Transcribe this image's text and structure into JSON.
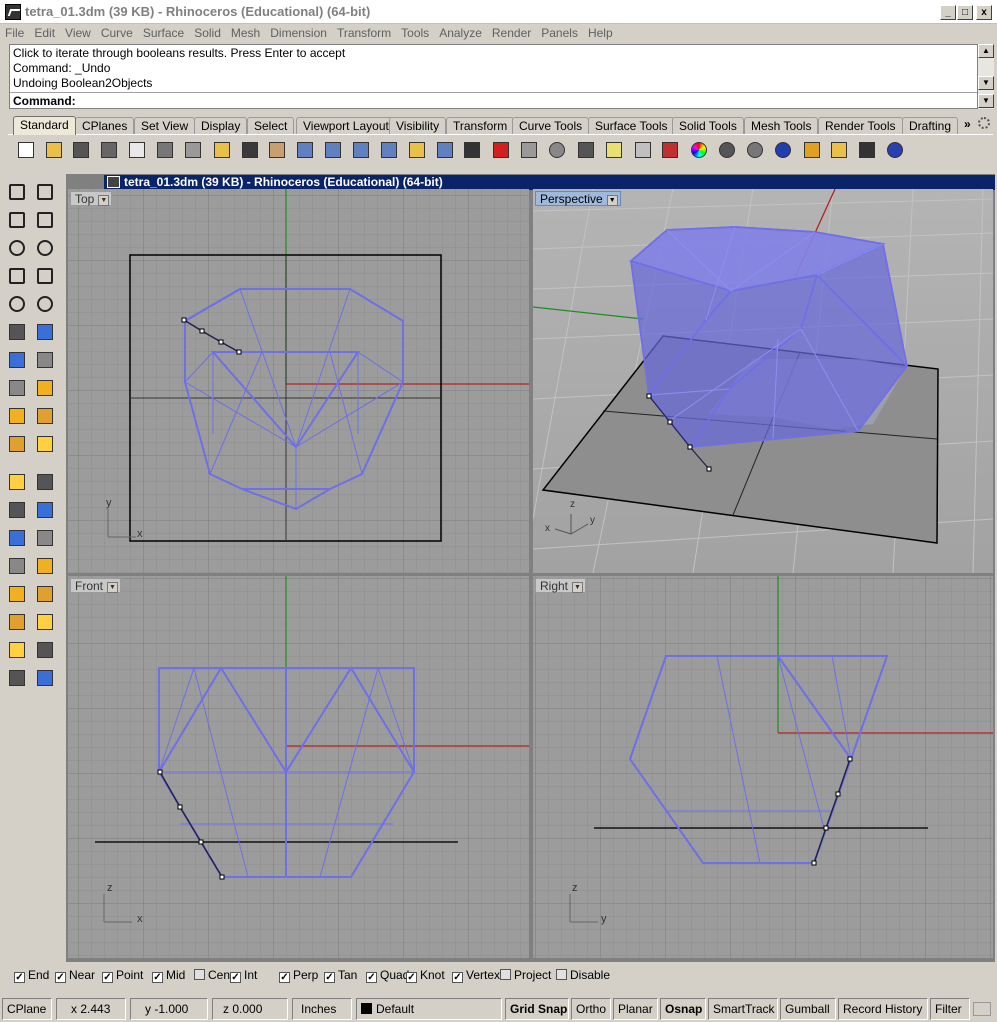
{
  "window": {
    "title": "tetra_01.3dm (39 KB) - Rhinoceros (Educational) (64-bit)",
    "min_label": "_",
    "max_label": "□",
    "close_label": "x"
  },
  "menu": [
    "File",
    "Edit",
    "View",
    "Curve",
    "Surface",
    "Solid",
    "Mesh",
    "Dimension",
    "Transform",
    "Tools",
    "Analyze",
    "Render",
    "Panels",
    "Help"
  ],
  "command": {
    "history": [
      "Click to iterate through booleans results. Press Enter to accept",
      "Command: _Undo",
      "Undoing Boolean2Objects"
    ],
    "prompt_label": "Command:",
    "value": ""
  },
  "toolbar_tabs": [
    "Standard",
    "CPlanes",
    "Set View",
    "Display",
    "Select",
    "Viewport Layout",
    "Visibility",
    "Transform",
    "Curve Tools",
    "Surface Tools",
    "Solid Tools",
    "Mesh Tools",
    "Render Tools",
    "Drafting"
  ],
  "tabs_overflow": "»",
  "standard_icons": [
    "new-file-icon",
    "open-folder-icon",
    "save-icon",
    "print-icon",
    "import-icon",
    "cut-icon",
    "copy-icon",
    "paste-icon",
    "undo-icon",
    "pan-hand-icon",
    "rotate-view-icon",
    "zoom-dynamic-icon",
    "zoom-window-icon",
    "zoom-extents-icon",
    "zoom-selected-icon",
    "undo-view-icon",
    "four-viewports-icon",
    "car-icon",
    "grid-icon",
    "circle-select-icon",
    "point-icon",
    "bulb-icon",
    "lock-icon",
    "layer-icon",
    "color-wheel-icon",
    "shaded-sphere-icon",
    "rendered-sphere-icon",
    "blue-sphere-icon",
    "pen-icon",
    "gear-icon",
    "dimension-icon",
    "help-icon"
  ],
  "mdi_title": "tetra_01.3dm (39 KB) - Rhinoceros (Educational) (64-bit)",
  "viewports": {
    "top": {
      "label": "Top",
      "axis_x": "x",
      "axis_y": "y"
    },
    "perspective": {
      "label": "Perspective",
      "axis_x": "x",
      "axis_y": "y",
      "axis_z": "z"
    },
    "front": {
      "label": "Front",
      "axis_x": "x",
      "axis_y": "z"
    },
    "right": {
      "label": "Right",
      "axis_x": "y",
      "axis_y": "z"
    }
  },
  "osnaps": [
    {
      "label": "End",
      "checked": true
    },
    {
      "label": "Near",
      "checked": true
    },
    {
      "label": "Point",
      "checked": true
    },
    {
      "label": "Mid",
      "checked": true
    },
    {
      "label": "Cen",
      "checked": false
    },
    {
      "label": "Int",
      "checked": true
    },
    {
      "label": "Perp",
      "checked": true
    },
    {
      "label": "Tan",
      "checked": true
    },
    {
      "label": "Quad",
      "checked": true
    },
    {
      "label": "Knot",
      "checked": true
    },
    {
      "label": "Vertex",
      "checked": true
    },
    {
      "label": "Project",
      "checked": false
    },
    {
      "label": "Disable",
      "checked": false
    }
  ],
  "status": {
    "cplane": "CPlane",
    "x": "x 2.443",
    "y": "y -1.000",
    "z": "z 0.000",
    "units": "Inches",
    "layer": "Default",
    "grid_snap": "Grid Snap",
    "ortho": "Ortho",
    "planar": "Planar",
    "osnap": "Osnap",
    "smarttrack": "SmartTrack",
    "gumball": "Gumball",
    "record_history": "Record History",
    "filter": "Filter"
  },
  "colors": {
    "object_wire": "#6f6fe6",
    "x_axis": "#b22222",
    "y_axis": "#228b22",
    "viewport_bg": "#9c9c9c",
    "active_viewport_label": "#9fb9dc"
  }
}
